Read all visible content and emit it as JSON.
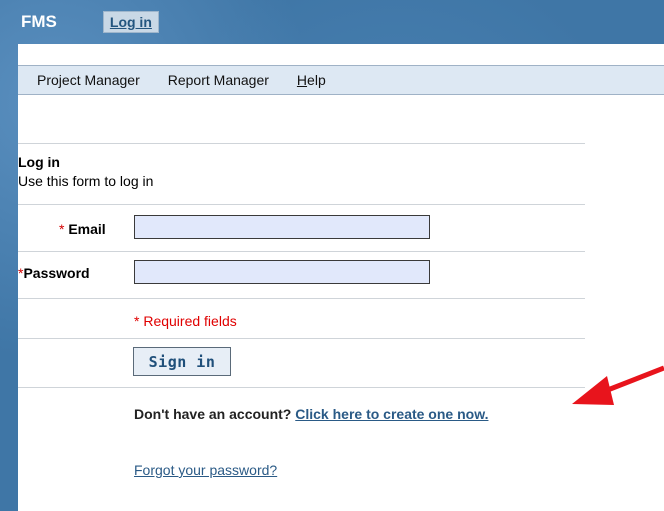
{
  "header": {
    "brand": "FMS",
    "login_tab": "Log in"
  },
  "menu": {
    "items": [
      {
        "label_pre": "Pro",
        "label_hl": "j",
        "label_post": "ect Manager"
      },
      {
        "label": "Report Manager"
      },
      {
        "label_hl": "H",
        "label_post": "elp"
      }
    ]
  },
  "form": {
    "title": "Log in",
    "subtitle": "Use this form to log in",
    "email_label": "Email",
    "password_label": "Password",
    "asterisk": "*",
    "email_value": "",
    "password_value": "",
    "required_note": "* Required fields",
    "signin_label": "Sign in",
    "account_prompt": "Don't have an account?",
    "create_link": "Click here to create one now.",
    "forgot_link": "Forgot your password?"
  },
  "colors": {
    "background": "#3f76a6",
    "arrow": "#e8141c",
    "required": "#e00000",
    "input_fill": "#e1e8fb"
  }
}
